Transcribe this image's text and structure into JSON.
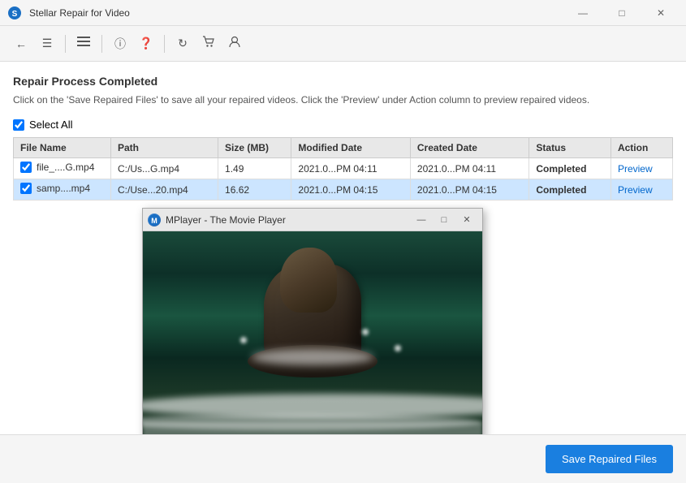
{
  "titleBar": {
    "title": "Stellar Repair for Video",
    "minimizeLabel": "—",
    "maximizeLabel": "□",
    "closeLabel": "✕"
  },
  "toolbar": {
    "backLabel": "←",
    "menuLabel": "≡",
    "listLabel": "≡",
    "infoLabel": "ℹ",
    "helpLabel": "?",
    "refreshLabel": "↺",
    "cartLabel": "🛒",
    "userLabel": "👤"
  },
  "mainArea": {
    "repairHeading": "Repair Process Completed",
    "repairSubtext": "Click on the 'Save Repaired Files' to save all your repaired videos. Click the 'Preview' under Action column to preview repaired videos.",
    "selectAllLabel": "Select All",
    "tableHeaders": [
      "File Name",
      "Path",
      "Size (MB)",
      "Modified Date",
      "Created Date",
      "Status",
      "Action"
    ],
    "tableRows": [
      {
        "checked": true,
        "fileName": "file_....G.mp4",
        "path": "C:/Us...G.mp4",
        "size": "1.49",
        "modifiedDate": "2021.0...PM 04:11",
        "createdDate": "2021.0...PM 04:11",
        "status": "Completed",
        "action": "Preview",
        "selected": false
      },
      {
        "checked": true,
        "fileName": "samp....mp4",
        "path": "C:/Use...20.mp4",
        "size": "16.62",
        "modifiedDate": "2021.0...PM 04:15",
        "createdDate": "2021.0...PM 04:15",
        "status": "Completed",
        "action": "Preview",
        "selected": true
      }
    ]
  },
  "mplayer": {
    "title": "MPlayer - The Movie Player",
    "iconLabel": "M",
    "minimizeLabel": "—",
    "maximizeLabel": "□",
    "closeLabel": "✕"
  },
  "bottomBar": {
    "saveButton": "Save Repaired Files"
  }
}
